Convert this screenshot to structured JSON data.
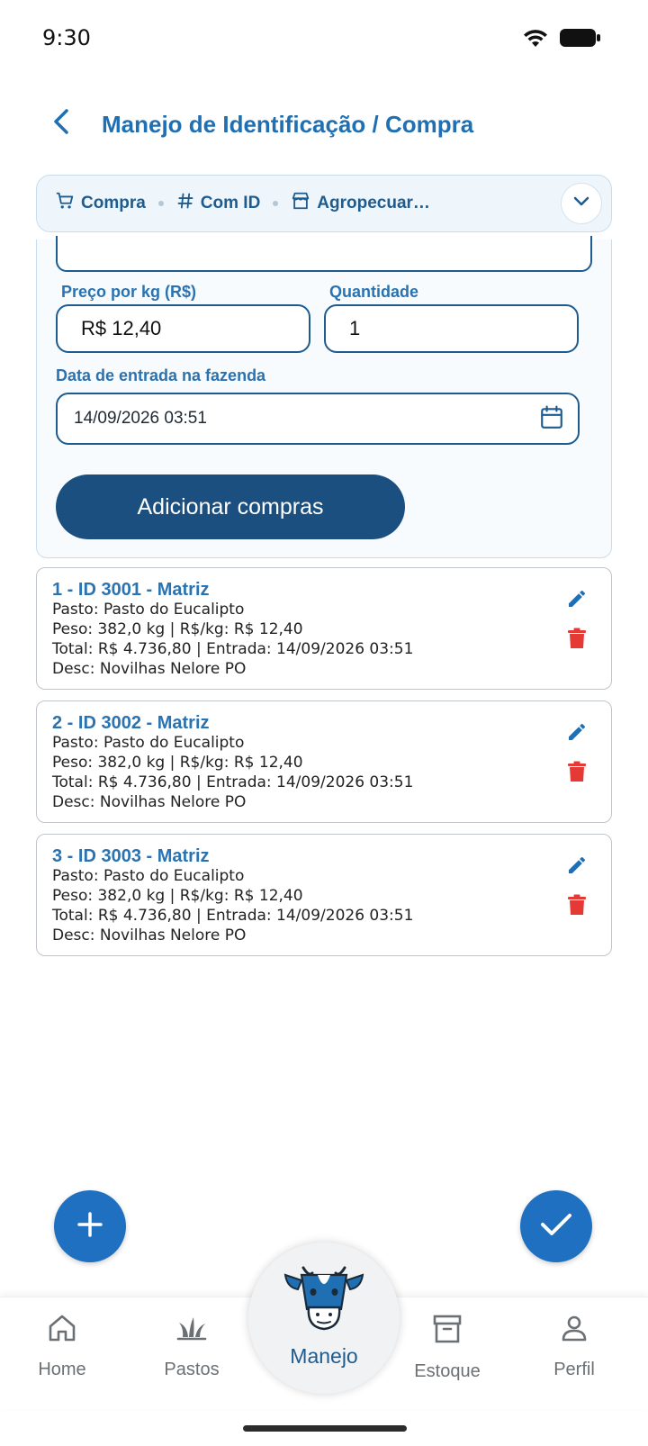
{
  "status_bar": {
    "time": "9:30"
  },
  "header": {
    "title": "Manejo de Identificação / Compra"
  },
  "summary": {
    "items": [
      {
        "icon": "cart-icon",
        "label": "Compra"
      },
      {
        "icon": "hash-icon",
        "label": "Com ID"
      },
      {
        "icon": "store-icon",
        "label": "Agropecuar…"
      }
    ]
  },
  "form": {
    "price_label": "Preço por kg (R$)",
    "price_value": "R$ 12,40",
    "quantity_label": "Quantidade",
    "quantity_value": "1",
    "date_label": "Data de entrada na fazenda",
    "date_value": "14/09/2026 03:51",
    "add_button": "Adicionar compras"
  },
  "purchases": [
    {
      "title": "1 - ID 3001 - Matriz",
      "pasto": "Pasto: Pasto do Eucalipto",
      "peso": "Peso: 382,0 kg | R$/kg: R$ 12,40",
      "total": "Total: R$ 4.736,80 | Entrada: 14/09/2026 03:51",
      "desc": "Desc: Novilhas Nelore PO"
    },
    {
      "title": "2 - ID 3002 - Matriz",
      "pasto": "Pasto: Pasto do Eucalipto",
      "peso": "Peso: 382,0 kg | R$/kg: R$ 12,40",
      "total": "Total: R$ 4.736,80 | Entrada: 14/09/2026 03:51",
      "desc": "Desc: Novilhas Nelore PO"
    },
    {
      "title": "3 - ID 3003 - Matriz",
      "pasto": "Pasto: Pasto do Eucalipto",
      "peso": "Peso: 382,0 kg | R$/kg: R$ 12,40",
      "total": "Total: R$ 4.736,80 | Entrada: 14/09/2026 03:51",
      "desc": "Desc: Novilhas Nelore PO"
    }
  ],
  "nav": {
    "home": "Home",
    "pastos": "Pastos",
    "manejo": "Manejo",
    "estoque": "Estoque",
    "perfil": "Perfil"
  },
  "colors": {
    "primary": "#1f6fb2",
    "dark_primary": "#1a4f80",
    "fab": "#1f70c1",
    "delete": "#e53935"
  }
}
